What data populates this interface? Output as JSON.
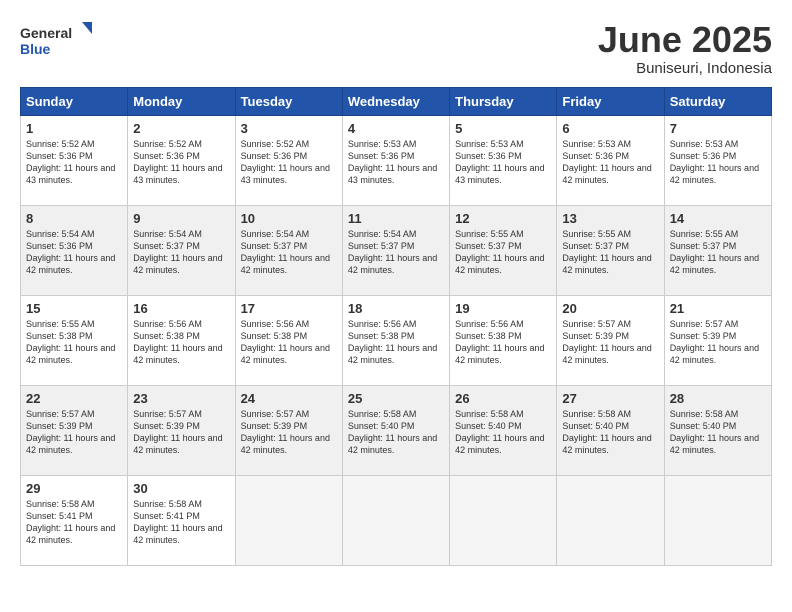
{
  "header": {
    "logo_general": "General",
    "logo_blue": "Blue",
    "title": "June 2025",
    "location": "Buniseuri, Indonesia"
  },
  "weekdays": [
    "Sunday",
    "Monday",
    "Tuesday",
    "Wednesday",
    "Thursday",
    "Friday",
    "Saturday"
  ],
  "weeks": [
    [
      {
        "day": 1,
        "sunrise": "5:52 AM",
        "sunset": "5:36 PM",
        "daylight": "11 hours and 43 minutes."
      },
      {
        "day": 2,
        "sunrise": "5:52 AM",
        "sunset": "5:36 PM",
        "daylight": "11 hours and 43 minutes."
      },
      {
        "day": 3,
        "sunrise": "5:52 AM",
        "sunset": "5:36 PM",
        "daylight": "11 hours and 43 minutes."
      },
      {
        "day": 4,
        "sunrise": "5:53 AM",
        "sunset": "5:36 PM",
        "daylight": "11 hours and 43 minutes."
      },
      {
        "day": 5,
        "sunrise": "5:53 AM",
        "sunset": "5:36 PM",
        "daylight": "11 hours and 43 minutes."
      },
      {
        "day": 6,
        "sunrise": "5:53 AM",
        "sunset": "5:36 PM",
        "daylight": "11 hours and 42 minutes."
      },
      {
        "day": 7,
        "sunrise": "5:53 AM",
        "sunset": "5:36 PM",
        "daylight": "11 hours and 42 minutes."
      }
    ],
    [
      {
        "day": 8,
        "sunrise": "5:54 AM",
        "sunset": "5:36 PM",
        "daylight": "11 hours and 42 minutes."
      },
      {
        "day": 9,
        "sunrise": "5:54 AM",
        "sunset": "5:37 PM",
        "daylight": "11 hours and 42 minutes."
      },
      {
        "day": 10,
        "sunrise": "5:54 AM",
        "sunset": "5:37 PM",
        "daylight": "11 hours and 42 minutes."
      },
      {
        "day": 11,
        "sunrise": "5:54 AM",
        "sunset": "5:37 PM",
        "daylight": "11 hours and 42 minutes."
      },
      {
        "day": 12,
        "sunrise": "5:55 AM",
        "sunset": "5:37 PM",
        "daylight": "11 hours and 42 minutes."
      },
      {
        "day": 13,
        "sunrise": "5:55 AM",
        "sunset": "5:37 PM",
        "daylight": "11 hours and 42 minutes."
      },
      {
        "day": 14,
        "sunrise": "5:55 AM",
        "sunset": "5:37 PM",
        "daylight": "11 hours and 42 minutes."
      }
    ],
    [
      {
        "day": 15,
        "sunrise": "5:55 AM",
        "sunset": "5:38 PM",
        "daylight": "11 hours and 42 minutes."
      },
      {
        "day": 16,
        "sunrise": "5:56 AM",
        "sunset": "5:38 PM",
        "daylight": "11 hours and 42 minutes."
      },
      {
        "day": 17,
        "sunrise": "5:56 AM",
        "sunset": "5:38 PM",
        "daylight": "11 hours and 42 minutes."
      },
      {
        "day": 18,
        "sunrise": "5:56 AM",
        "sunset": "5:38 PM",
        "daylight": "11 hours and 42 minutes."
      },
      {
        "day": 19,
        "sunrise": "5:56 AM",
        "sunset": "5:38 PM",
        "daylight": "11 hours and 42 minutes."
      },
      {
        "day": 20,
        "sunrise": "5:57 AM",
        "sunset": "5:39 PM",
        "daylight": "11 hours and 42 minutes."
      },
      {
        "day": 21,
        "sunrise": "5:57 AM",
        "sunset": "5:39 PM",
        "daylight": "11 hours and 42 minutes."
      }
    ],
    [
      {
        "day": 22,
        "sunrise": "5:57 AM",
        "sunset": "5:39 PM",
        "daylight": "11 hours and 42 minutes."
      },
      {
        "day": 23,
        "sunrise": "5:57 AM",
        "sunset": "5:39 PM",
        "daylight": "11 hours and 42 minutes."
      },
      {
        "day": 24,
        "sunrise": "5:57 AM",
        "sunset": "5:39 PM",
        "daylight": "11 hours and 42 minutes."
      },
      {
        "day": 25,
        "sunrise": "5:58 AM",
        "sunset": "5:40 PM",
        "daylight": "11 hours and 42 minutes."
      },
      {
        "day": 26,
        "sunrise": "5:58 AM",
        "sunset": "5:40 PM",
        "daylight": "11 hours and 42 minutes."
      },
      {
        "day": 27,
        "sunrise": "5:58 AM",
        "sunset": "5:40 PM",
        "daylight": "11 hours and 42 minutes."
      },
      {
        "day": 28,
        "sunrise": "5:58 AM",
        "sunset": "5:40 PM",
        "daylight": "11 hours and 42 minutes."
      }
    ],
    [
      {
        "day": 29,
        "sunrise": "5:58 AM",
        "sunset": "5:41 PM",
        "daylight": "11 hours and 42 minutes."
      },
      {
        "day": 30,
        "sunrise": "5:58 AM",
        "sunset": "5:41 PM",
        "daylight": "11 hours and 42 minutes."
      },
      null,
      null,
      null,
      null,
      null
    ]
  ]
}
